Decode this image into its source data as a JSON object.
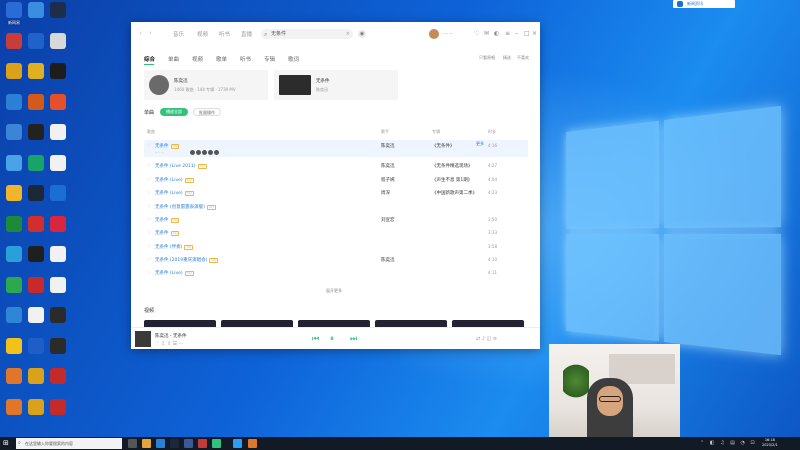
{
  "desktop": {
    "icons": [
      {
        "label": "新网易",
        "color": "#2b6bd6"
      },
      {
        "label": "",
        "color": "#3a8de0"
      },
      {
        "label": "",
        "color": "#1d2d4a"
      },
      {
        "label": "",
        "color": "#c83c3c"
      },
      {
        "label": "",
        "color": "#1f63c9"
      },
      {
        "label": "",
        "color": "#d8d8d8"
      },
      {
        "label": "",
        "color": "#d9a21a"
      },
      {
        "label": "",
        "color": "#e0b021"
      },
      {
        "label": "",
        "color": "#1d1d1d"
      },
      {
        "label": "",
        "color": "#2a7fd6"
      },
      {
        "label": "",
        "color": "#d45a1c"
      },
      {
        "label": "",
        "color": "#e5502a"
      },
      {
        "label": "",
        "color": "#3b84d6"
      },
      {
        "label": "",
        "color": "#222"
      },
      {
        "label": "",
        "color": "#f1f1f1"
      },
      {
        "label": "",
        "color": "#4aa3e8"
      },
      {
        "label": "",
        "color": "#19a36b"
      },
      {
        "label": "",
        "color": "#f1f1f1"
      },
      {
        "label": "",
        "color": "#f0b52a"
      },
      {
        "label": "",
        "color": "#1b2838"
      },
      {
        "label": "",
        "color": "#1b6fd0"
      },
      {
        "label": "",
        "color": "#1d8a3a"
      },
      {
        "label": "",
        "color": "#d12e2e"
      },
      {
        "label": "",
        "color": "#d7263d"
      },
      {
        "label": "",
        "color": "#2aa0da"
      },
      {
        "label": "",
        "color": "#1f1f1f"
      },
      {
        "label": "",
        "color": "#f1f1f1"
      },
      {
        "label": "",
        "color": "#2da84f"
      },
      {
        "label": "",
        "color": "#c72a2a"
      },
      {
        "label": "",
        "color": "#f1f1f1"
      },
      {
        "label": "",
        "color": "#2d86d8"
      },
      {
        "label": "",
        "color": "#f1f1f1"
      },
      {
        "label": "",
        "color": "#2b2b2b"
      },
      {
        "label": "",
        "color": "#f2c21b"
      },
      {
        "label": "",
        "color": "#1f5ec9"
      },
      {
        "label": "",
        "color": "#2b2b2b"
      },
      {
        "label": "",
        "color": "#e0762a"
      },
      {
        "label": "",
        "color": "#d9a21a"
      },
      {
        "label": "",
        "color": "#c32b2b"
      },
      {
        "label": "",
        "color": "#e0762a"
      },
      {
        "label": "",
        "color": "#d9a21a"
      },
      {
        "label": "",
        "color": "#c32b2b"
      }
    ],
    "tray_popup": "新闻资讯"
  },
  "app": {
    "nav": [
      "音乐",
      "视频",
      "听书",
      "直播"
    ],
    "search_value": "无条件",
    "tabs": [
      "综合",
      "单曲",
      "视频",
      "歌单",
      "听书",
      "专辑",
      "歌词"
    ],
    "options": [
      "只看原唱",
      "精选",
      "不喜欢"
    ],
    "artist_card": {
      "name": "陈奕迅",
      "info": "1460 歌曲 · 144 专辑 · 1739 MV"
    },
    "song_card": {
      "title": "无条件",
      "artist": "陈奕迅"
    },
    "section_title": "单曲",
    "play_all": "播放全部",
    "batch": "批量操作",
    "headers": [
      "歌曲",
      "歌手",
      "专辑",
      "时长"
    ],
    "songs": [
      {
        "title": "无条件",
        "tags": "",
        "artist": "陈奕迅",
        "album": "《无条件》",
        "duration": "4:16"
      },
      {
        "title": "无条件 (Live 2011)",
        "tags": "",
        "artist": "陈奕迅",
        "album": "《无条件精选现场》",
        "duration": "4:27"
      },
      {
        "title": "无条件 (Live)",
        "tags": "",
        "artist": "程子嫣",
        "album": "《声生不息 第1期》",
        "duration": "4:04"
      },
      {
        "title": "无条件 (Live)",
        "tags": "",
        "artist": "周深",
        "album": "《中国新歌声第二季》",
        "duration": "4:23"
      },
      {
        "title": "无条件 (创意雷霆表演版)",
        "tags": "",
        "artist": "",
        "album": "",
        "duration": ""
      },
      {
        "title": "无条件",
        "tags": "",
        "artist": "刘宣宏",
        "album": "",
        "duration": "3:50"
      },
      {
        "title": "无条件",
        "tags": "",
        "artist": "",
        "album": "",
        "duration": "3:33"
      },
      {
        "title": "无条件 (伴奏)",
        "tags": "",
        "artist": "",
        "album": "",
        "duration": "3:58"
      },
      {
        "title": "无条件 (2019重庆演唱会)",
        "tags": "",
        "artist": "陈奕迅",
        "album": "",
        "duration": "4:10"
      },
      {
        "title": "无条件 (Live)",
        "tags": "",
        "artist": "",
        "album": "",
        "duration": "4:11"
      }
    ],
    "more_link": "更多",
    "show_more": "展开更多",
    "video_section": "视频",
    "player": {
      "now_playing": "陈奕迅 - 无条件",
      "time": ""
    }
  },
  "taskbar": {
    "search_placeholder": "在这里输入你要搜索的内容",
    "time": "16:18",
    "date": "2023/2/1"
  }
}
